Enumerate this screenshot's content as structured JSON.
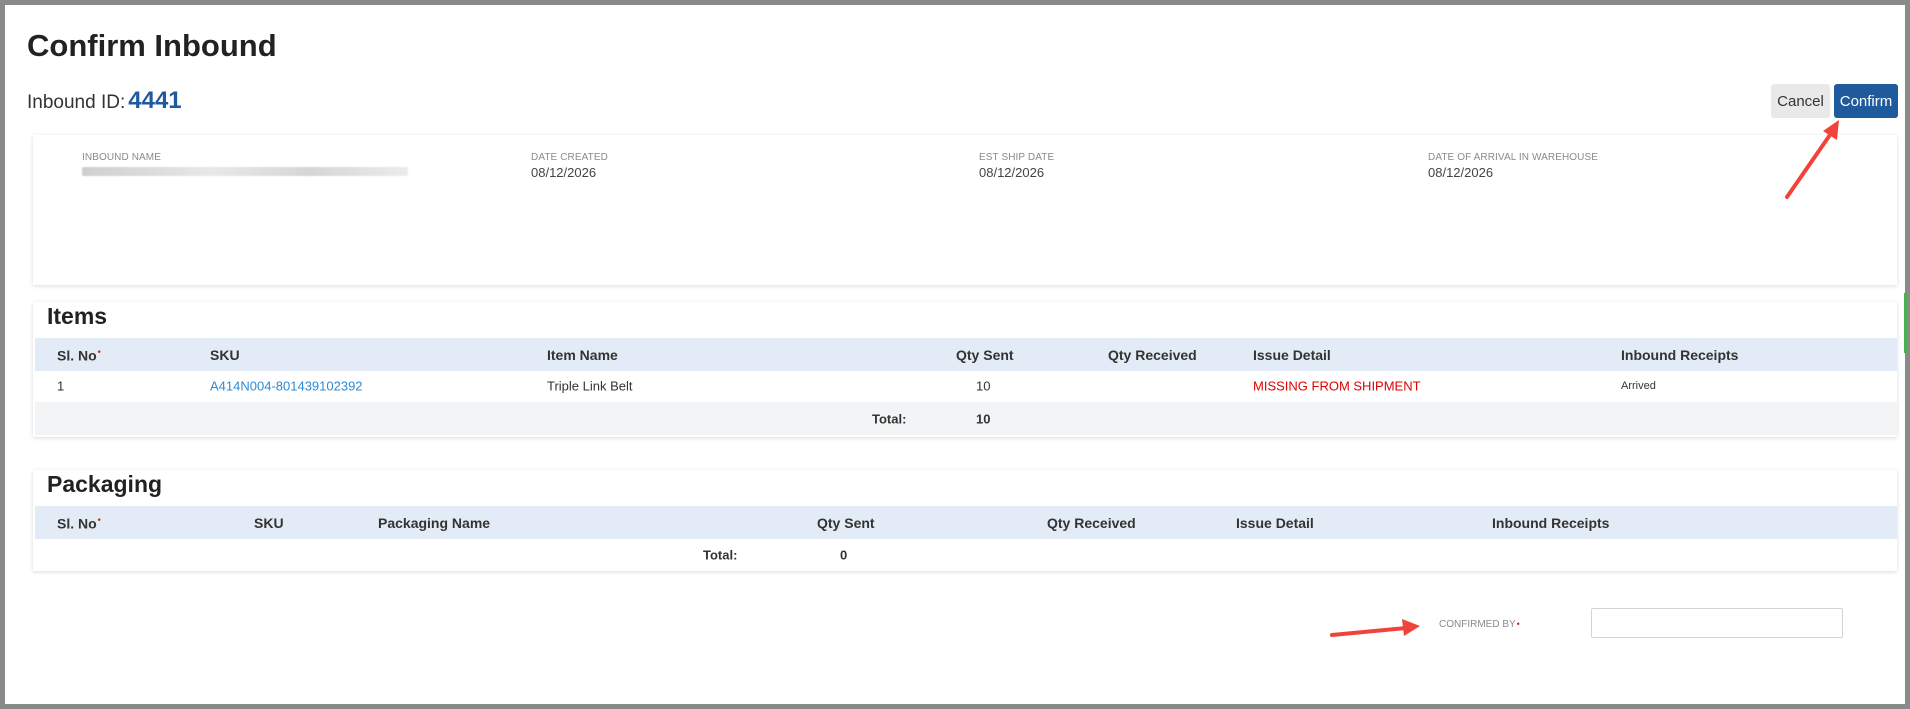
{
  "page": {
    "title": "Confirm Inbound",
    "inbound_id_label": "Inbound ID:",
    "inbound_id_value": "4441"
  },
  "actions": {
    "cancel_label": "Cancel",
    "confirm_label": "Confirm"
  },
  "info": {
    "inbound_name_label": "INBOUND NAME",
    "date_created_label": "DATE CREATED",
    "date_created_value": "08/12/2026",
    "est_ship_date_label": "EST SHIP DATE",
    "est_ship_date_value": "08/12/2026",
    "arrival_label": "DATE OF ARRIVAL IN WAREHOUSE",
    "arrival_value": "08/12/2026"
  },
  "items": {
    "title": "Items",
    "headers": {
      "sl_no": "Sl. No",
      "sku": "SKU",
      "item_name": "Item Name",
      "qty_sent": "Qty Sent",
      "qty_received": "Qty Received",
      "issue_detail": "Issue Detail",
      "inbound_receipts": "Inbound Receipts"
    },
    "rows": [
      {
        "sl_no": "1",
        "sku": "A414N004-801439102392",
        "item_name": "Triple Link Belt",
        "qty_sent": "10",
        "qty_received": "",
        "issue_detail": "MISSING FROM SHIPMENT",
        "inbound_receipts": "Arrived"
      }
    ],
    "total_label": "Total:",
    "total_value": "10"
  },
  "packaging": {
    "title": "Packaging",
    "headers": {
      "sl_no": "Sl. No",
      "sku": "SKU",
      "packaging_name": "Packaging Name",
      "qty_sent": "Qty Sent",
      "qty_received": "Qty Received",
      "issue_detail": "Issue Detail",
      "inbound_receipts": "Inbound Receipts"
    },
    "total_label": "Total:",
    "total_value": "0"
  },
  "confirmed_by": {
    "label": "CONFIRMED BY",
    "value": ""
  },
  "colors": {
    "primary": "#1e5a9c",
    "link": "#2b8bd6",
    "issue": "#e00000",
    "annotation_arrow": "#f0433a"
  }
}
